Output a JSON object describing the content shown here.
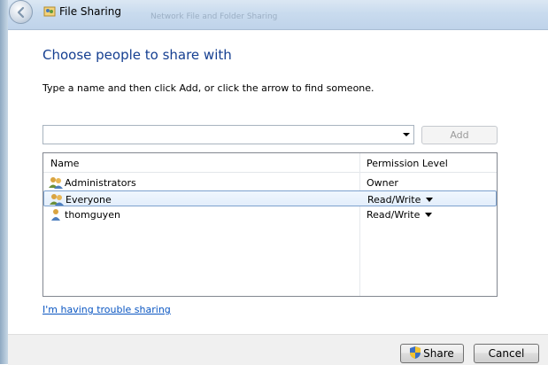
{
  "window": {
    "title": "File Sharing",
    "ghost_text": "Network File and Folder Sharing"
  },
  "main": {
    "heading": "Choose people to share with",
    "instructions": "Type a name and then click Add, or click the arrow to find someone.",
    "name_input_value": "",
    "add_label": "Add",
    "list": {
      "columns": [
        "Name",
        "Permission Level"
      ],
      "rows": [
        {
          "name": "Administrators",
          "permission": "Owner",
          "icon": "group-icon",
          "selected": false,
          "has_dropdown": false
        },
        {
          "name": "Everyone",
          "permission": "Read/Write",
          "icon": "group-icon",
          "selected": true,
          "has_dropdown": true
        },
        {
          "name": "thomguyen",
          "permission": "Read/Write",
          "icon": "user-icon",
          "selected": false,
          "has_dropdown": true
        }
      ]
    },
    "trouble_link": "I'm having trouble sharing"
  },
  "footer": {
    "share_label": "Share",
    "cancel_label": "Cancel"
  },
  "colors": {
    "heading": "#153f91",
    "link": "#0a56c2",
    "selection_border": "#7da2ce"
  }
}
